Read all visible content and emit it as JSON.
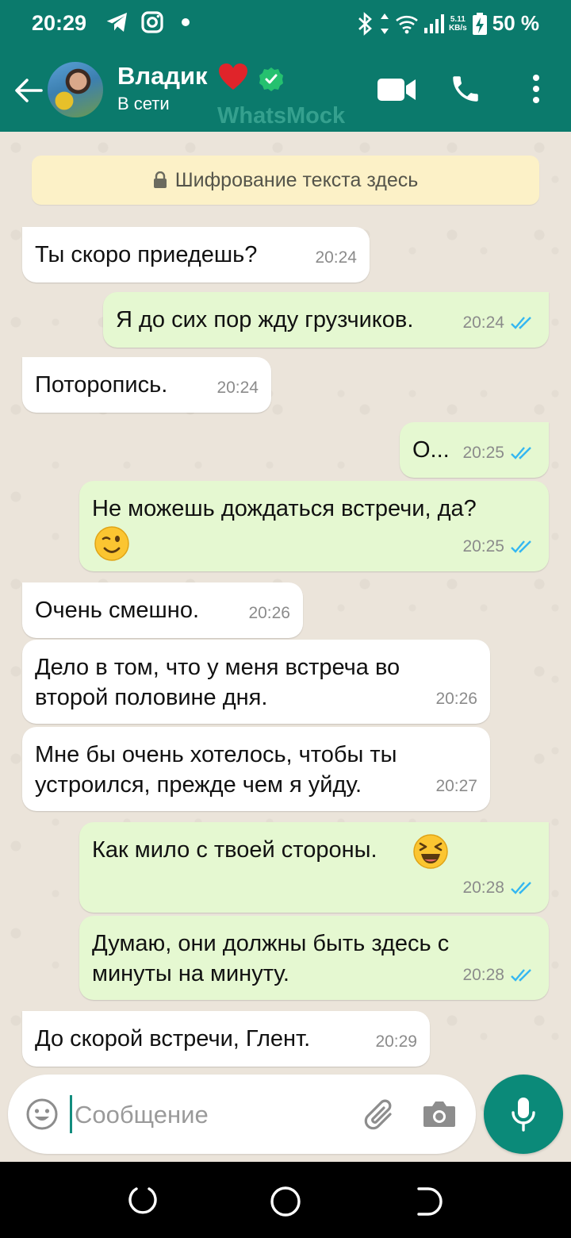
{
  "status_bar": {
    "time": "20:29",
    "network_speed_top": "5.11",
    "network_speed_bottom": "KB/s",
    "battery": "50 %"
  },
  "header": {
    "contact_name": "Владик",
    "status": "В сети",
    "watermark": "WhatsMock",
    "icons": [
      "back-arrow-icon",
      "heart-icon",
      "verified-icon",
      "video-call-icon",
      "phone-icon",
      "more-vert-icon"
    ]
  },
  "chat": {
    "encryption_notice": "Шифрование текста здесь",
    "messages": [
      {
        "dir": "in",
        "text": "Ты скоро приедешь?",
        "time": "20:24"
      },
      {
        "dir": "out",
        "text": "Я до сих пор жду грузчиков.",
        "time": "20:24"
      },
      {
        "dir": "in",
        "text": "Поторопись.",
        "time": "20:24"
      },
      {
        "dir": "out",
        "text": "О...",
        "time": "20:25"
      },
      {
        "dir": "out",
        "text": "Не можешь дождаться встречи, да?",
        "emoji": "wink",
        "time": "20:25"
      },
      {
        "dir": "in",
        "text": "Очень смешно.",
        "time": "20:26"
      },
      {
        "dir": "in",
        "text": "Дело в том, что у меня встреча во\nвторой половине дня.",
        "time": "20:26"
      },
      {
        "dir": "in",
        "text": "Мне бы очень хотелось, чтобы ты\nустроился, прежде чем я уйду.",
        "time": "20:27"
      },
      {
        "dir": "out",
        "text": "Как мило с твоей стороны.",
        "emoji": "laughing",
        "time": "20:28"
      },
      {
        "dir": "out",
        "text": "Думаю, они должны быть здесь с\nминуты на минуту.",
        "time": "20:28"
      },
      {
        "dir": "in",
        "text": "До скорой встречи, Глент.",
        "time": "20:29"
      }
    ]
  },
  "composer": {
    "placeholder": "Сообщение"
  },
  "colors": {
    "header": "#0b7a6c",
    "incoming_bubble": "#ffffff",
    "outgoing_bubble": "#e5f8d1",
    "read_ticks": "#34b7f1",
    "mic_button": "#0b8a79"
  }
}
